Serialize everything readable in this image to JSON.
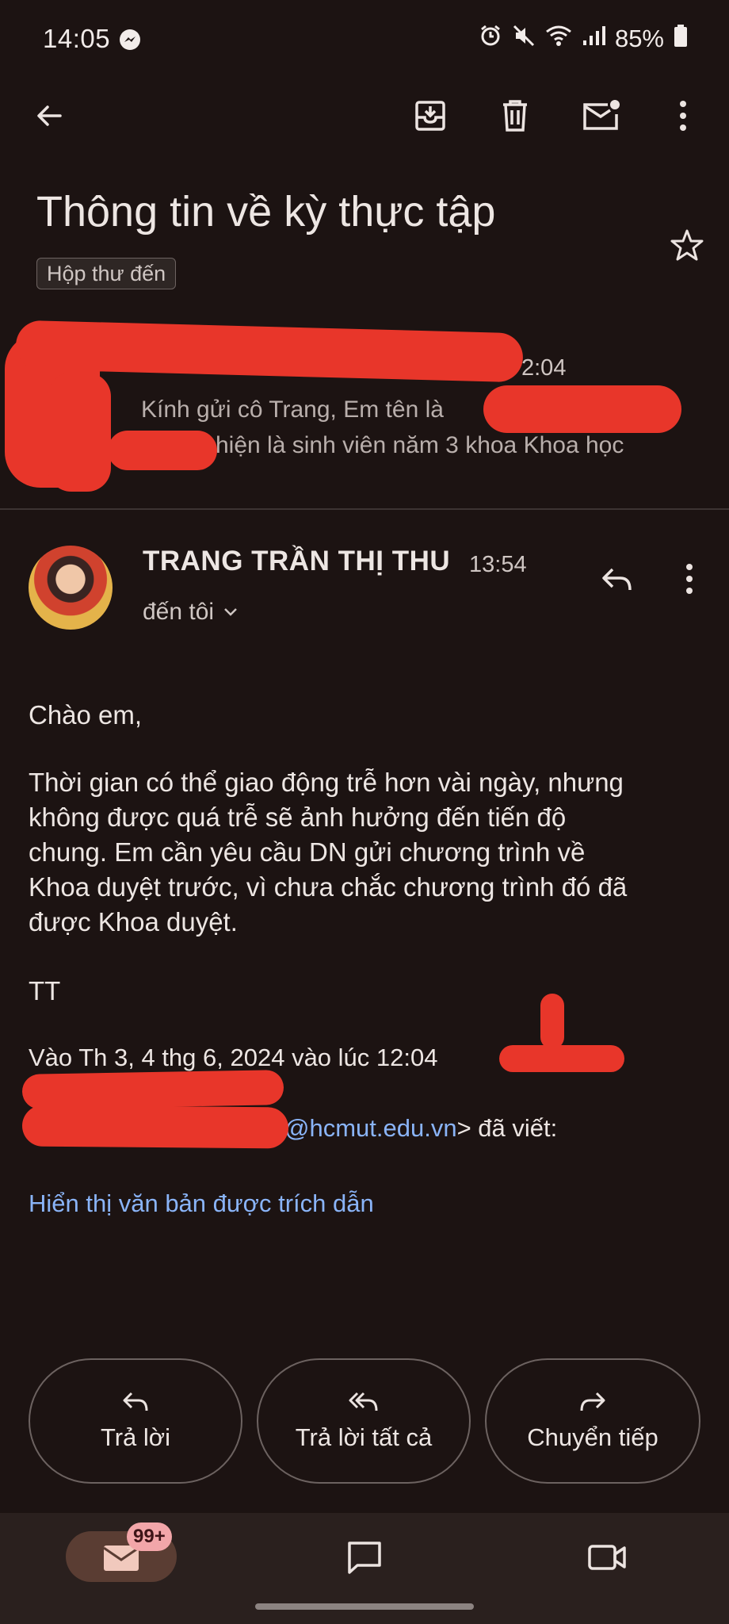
{
  "status_bar": {
    "time": "14:05",
    "battery": "85%"
  },
  "toolbar": {
    "back_icon": "arrow-back-icon",
    "archive_icon": "archive-icon",
    "delete_icon": "trash-icon",
    "unread_icon": "mark-unread-icon",
    "more_icon": "more-vert-icon"
  },
  "email": {
    "subject": "Thông tin về kỳ thực tập",
    "label": "Hộp thư đến"
  },
  "collapsed_message": {
    "time": "2:04",
    "snippet_line1": "Kính gửi cô Trang, Em tên là",
    "snippet_line2": "hiện là sinh viên năm 3 khoa Khoa học"
  },
  "message": {
    "sender": "TRANG TRẦN THỊ THU",
    "time": "13:54",
    "to": "đến tôi",
    "greeting": "Chào em,",
    "body_lines": [
      "Thời gian có thể giao động trễ hơn vài ngày, nhưng",
      "không được quá trễ sẽ ảnh hưởng đến tiến độ",
      "chung. Em cần yêu cầu DN gửi chương trình về",
      "Khoa duyệt trước, vì chưa chắc chương trình đó đã",
      "được Khoa duyệt."
    ],
    "signature": "TT",
    "quote_header": "Vào Th 3, 4 thg 6, 2024 vào lúc 12:04",
    "quote_email": "@hcmut.edu.vn",
    "quote_suffix": "> đã viết:",
    "show_quoted": "Hiển thị văn bản được trích dẫn"
  },
  "actions": {
    "reply": "Trả lời",
    "reply_all": "Trả lời tất cả",
    "forward": "Chuyển tiếp"
  },
  "bottom_nav": {
    "mail_badge": "99+"
  },
  "colors": {
    "background": "#1c1312",
    "link": "#8ab4f8",
    "redaction": "#e8362a"
  }
}
